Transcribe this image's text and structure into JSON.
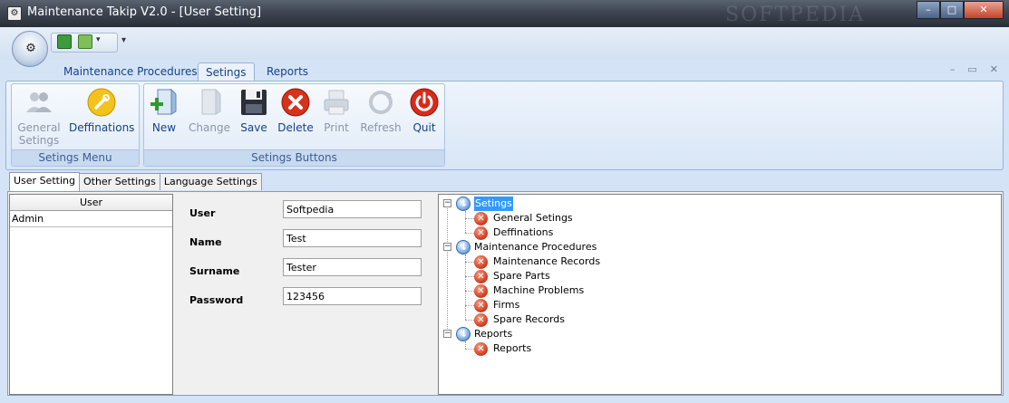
{
  "window": {
    "title": "Maintenance Takip V2.0 - [User Setting]",
    "watermark": "SOFTPEDIA",
    "minimize": "–",
    "maximize": "□",
    "close": "✕"
  },
  "ribbon_tabs": [
    {
      "label": "Maintenance Procedures",
      "active": false
    },
    {
      "label": "Setings",
      "active": true
    },
    {
      "label": "Reports",
      "active": false
    }
  ],
  "mdi": {
    "minimize": "–",
    "restore": "▭",
    "close": "✕"
  },
  "groups": {
    "settings_menu": {
      "caption": "Setings Menu",
      "buttons": [
        {
          "label": "General\nSetings",
          "enabled": false,
          "icon": "users-icon"
        },
        {
          "label": "Deffinations",
          "enabled": true,
          "icon": "wrench-icon"
        }
      ]
    },
    "settings_buttons": {
      "caption": "Setings Buttons",
      "buttons": [
        {
          "label": "New",
          "enabled": true,
          "icon": "new-document-icon"
        },
        {
          "label": "Change",
          "enabled": false,
          "icon": "edit-document-icon"
        },
        {
          "label": "Save",
          "enabled": true,
          "icon": "floppy-icon"
        },
        {
          "label": "Delete",
          "enabled": true,
          "icon": "delete-icon"
        },
        {
          "label": "Print",
          "enabled": false,
          "icon": "printer-icon"
        },
        {
          "label": "Refresh",
          "enabled": false,
          "icon": "refresh-icon"
        },
        {
          "label": "Quit",
          "enabled": true,
          "icon": "power-icon"
        }
      ]
    }
  },
  "content_tabs": [
    {
      "label": "User Setting",
      "active": true
    },
    {
      "label": "Other Settings",
      "active": false
    },
    {
      "label": "Language Settings",
      "active": false
    }
  ],
  "user_grid": {
    "header": "User",
    "rows": [
      "Admin"
    ]
  },
  "form": {
    "user": {
      "label": "User",
      "value": "Softpedia"
    },
    "name": {
      "label": "Name",
      "value": "Test"
    },
    "surname": {
      "label": "Surname",
      "value": "Tester"
    },
    "password": {
      "label": "Password",
      "value": "123456"
    }
  },
  "tree": {
    "setings": {
      "label": "Setings",
      "children": [
        "General Setings",
        "Deffinations"
      ]
    },
    "maintenance": {
      "label": "Maintenance Procedures",
      "children": [
        "Maintenance Records",
        "Spare Parts",
        "Machine Problems",
        "Firms",
        "Spare Records"
      ]
    },
    "reports": {
      "label": "Reports",
      "children": [
        "Reports"
      ]
    }
  },
  "colors": {
    "ribbon_text": "#15428b",
    "disabled_text": "#8a96a6",
    "selection": "#3399ff"
  }
}
